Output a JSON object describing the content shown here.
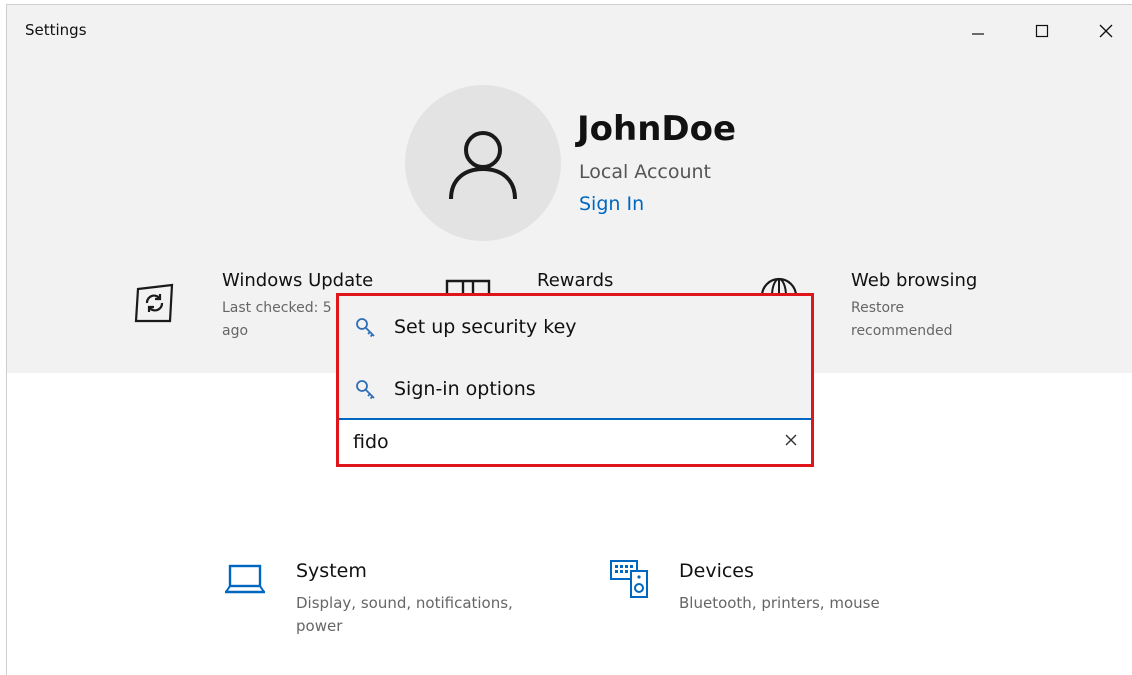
{
  "window": {
    "title": "Settings"
  },
  "profile": {
    "name": "JohnDoe",
    "account_type": "Local Account",
    "sign_in_label": "Sign In"
  },
  "quick_links": [
    {
      "title": "Windows Update",
      "subtitle": "Last checked: 5 ago",
      "subtitle_visible_line1": "Last checked: 5",
      "subtitle_visible_line2": "ago",
      "icon": "refresh-update-icon"
    },
    {
      "title": "Rewards",
      "icon": "rewards-icon"
    },
    {
      "title": "Web browsing",
      "subtitle_line1": "Restore",
      "subtitle_line2": "recommended",
      "icon": "globe-icon"
    }
  ],
  "search": {
    "value": "fido",
    "suggestions": [
      {
        "label": "Set up security key",
        "icon": "key-icon"
      },
      {
        "label": "Sign-in options",
        "icon": "key-icon"
      }
    ]
  },
  "categories": [
    {
      "title": "System",
      "subtitle_line1": "Display, sound, notifications,",
      "subtitle_line2": "power",
      "icon": "laptop-icon"
    },
    {
      "title": "Devices",
      "subtitle_line1": "Bluetooth, printers, mouse",
      "icon": "devices-icon"
    }
  ],
  "colors": {
    "accent": "#0067c0",
    "highlight_border": "#e0141b",
    "header_band": "#f2f2f2"
  }
}
